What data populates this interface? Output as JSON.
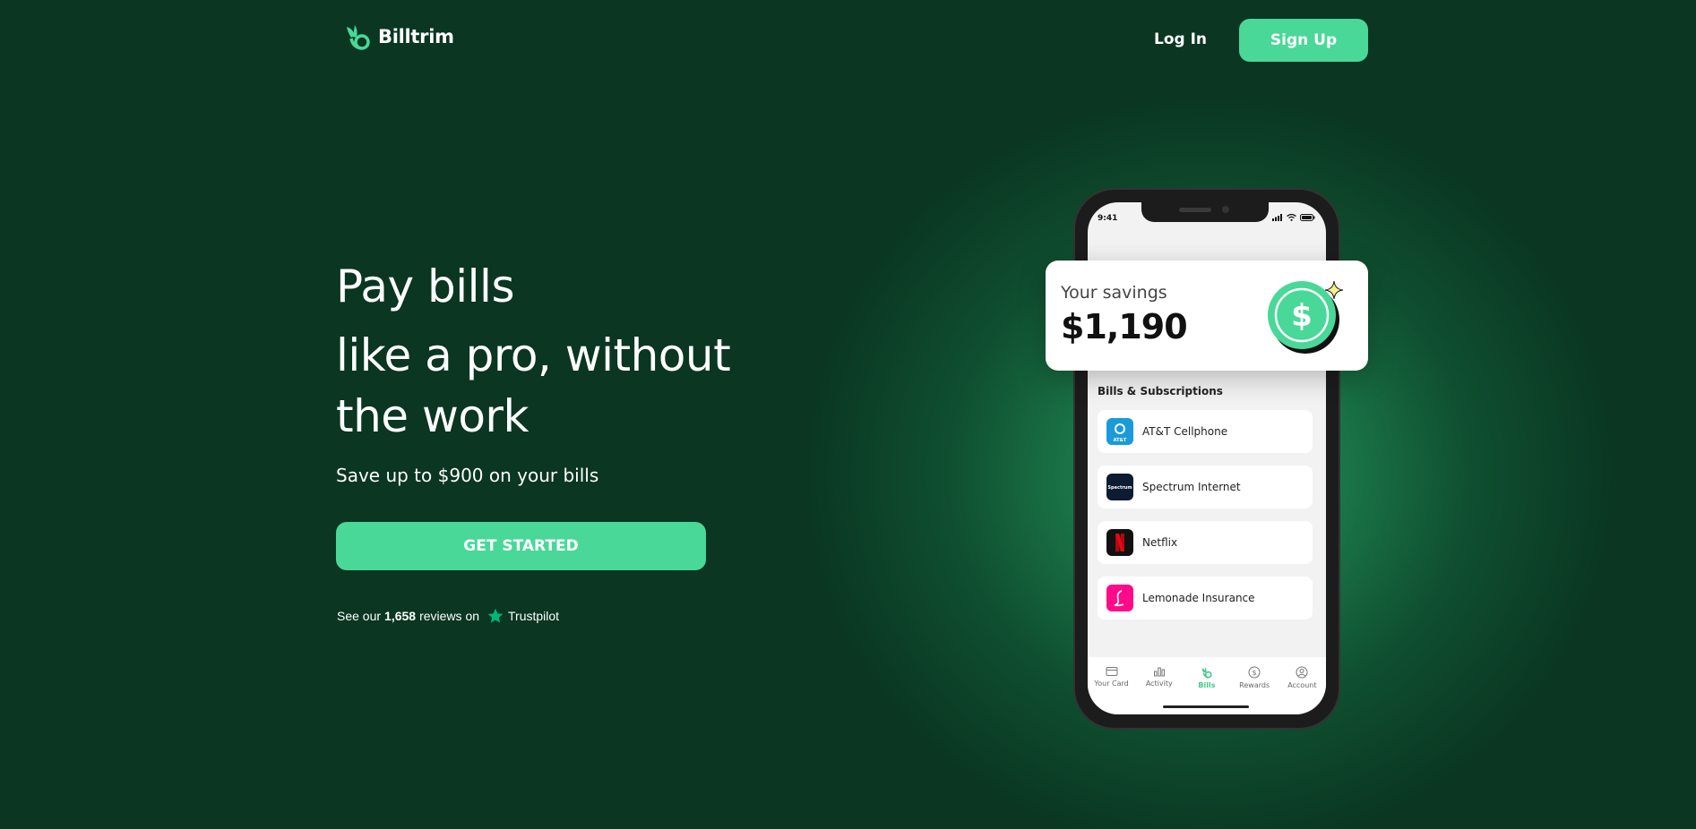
{
  "header": {
    "logo_text": "Billtrim",
    "login_label": "Log In",
    "signup_label": "Sign Up"
  },
  "hero": {
    "line1": "Pay bills",
    "line2": "like a pro, without",
    "line3": "the work",
    "subtitle": "Save up to $900 on your bills",
    "cta_label": "GET STARTED",
    "trust_prefix": "See our",
    "trust_count": "1,658",
    "trust_mid": "reviews on",
    "trust_brand": "Trustpilot"
  },
  "phone": {
    "time": "9:41",
    "savings_label": "Your savings",
    "savings_value": "$1,190",
    "section_title": "Bills & Subscriptions",
    "bills": [
      {
        "label": "AT&T Cellphone",
        "icon_text": "AT&T",
        "color": "#1a9ad9"
      },
      {
        "label": "Spectrum Internet",
        "icon_text": "Spectrum",
        "color": "#0d1b33"
      },
      {
        "label": "Netflix",
        "icon_text": "N",
        "color": "#111111"
      },
      {
        "label": "Lemonade Insurance",
        "icon_text": "L",
        "color": "#ff0a8a"
      }
    ],
    "tabs": [
      {
        "label": "Your Card",
        "icon": "card-icon"
      },
      {
        "label": "Activity",
        "icon": "chart-icon"
      },
      {
        "label": "Bills",
        "icon": "billtrim-icon"
      },
      {
        "label": "Rewards",
        "icon": "dollar-circle-icon"
      },
      {
        "label": "Account",
        "icon": "user-circle-icon"
      }
    ]
  },
  "colors": {
    "background": "#0a3622",
    "accent": "#49d898"
  }
}
